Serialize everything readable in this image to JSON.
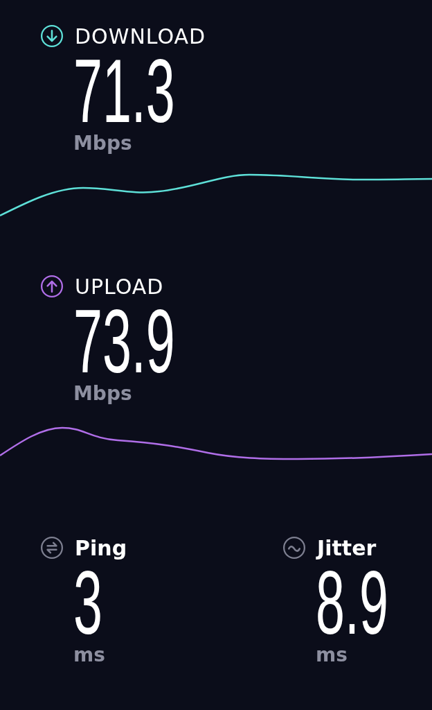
{
  "metrics": [
    {
      "kind": "download",
      "label": "DOWNLOAD",
      "value": "71.3",
      "unit": "Mbps"
    },
    {
      "kind": "upload",
      "label": "UPLOAD",
      "value": "73.9",
      "unit": "Mbps"
    },
    {
      "kind": "ping",
      "label": "Ping",
      "value": "3",
      "unit": "ms"
    },
    {
      "kind": "jitter",
      "label": "Jitter",
      "value": "8.9",
      "unit": "ms"
    }
  ]
}
